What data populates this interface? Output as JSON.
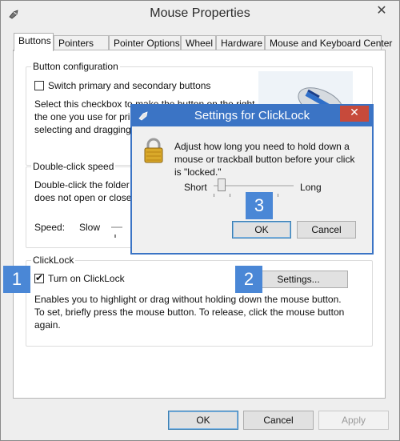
{
  "window": {
    "title": "Mouse Properties",
    "close": "✕"
  },
  "tabs": [
    "Buttons",
    "Pointers",
    "Pointer Options",
    "Wheel",
    "Hardware",
    "Mouse and Keyboard Center"
  ],
  "button_config": {
    "group_title": "Button configuration",
    "switch_label": "Switch primary and secondary buttons",
    "desc": [
      "Select this checkbox to make the button on the right",
      "the one you use for prim",
      "selecting and dragging"
    ]
  },
  "double_click": {
    "group_title": "Double-click speed",
    "desc": [
      "Double-click the folder t",
      "does not open or close"
    ],
    "speed_label": "Speed:",
    "slow_label": "Slow"
  },
  "clicklock": {
    "group_title": "ClickLock",
    "checkbox_label": "Turn on ClickLock",
    "checked": true,
    "settings_button": "Settings...",
    "desc": [
      "Enables you to highlight or drag without holding down the mouse button.",
      "To set, briefly press the mouse button. To release, click the mouse button",
      "again."
    ]
  },
  "footer": {
    "ok": "OK",
    "cancel": "Cancel",
    "apply": "Apply"
  },
  "dialog": {
    "title": "Settings for ClickLock",
    "close": "✕",
    "desc": [
      "Adjust how long you need to hold down a",
      "mouse or trackball button before your click",
      "is \"locked.\""
    ],
    "short_label": "Short",
    "long_label": "Long",
    "slider_level": 0.1,
    "ok": "OK",
    "cancel": "Cancel"
  },
  "badges": [
    "1",
    "2",
    "3"
  ],
  "colors": {
    "accent": "#3b74c5",
    "badge": "#4a87d6",
    "close_red": "#c74a3b"
  }
}
